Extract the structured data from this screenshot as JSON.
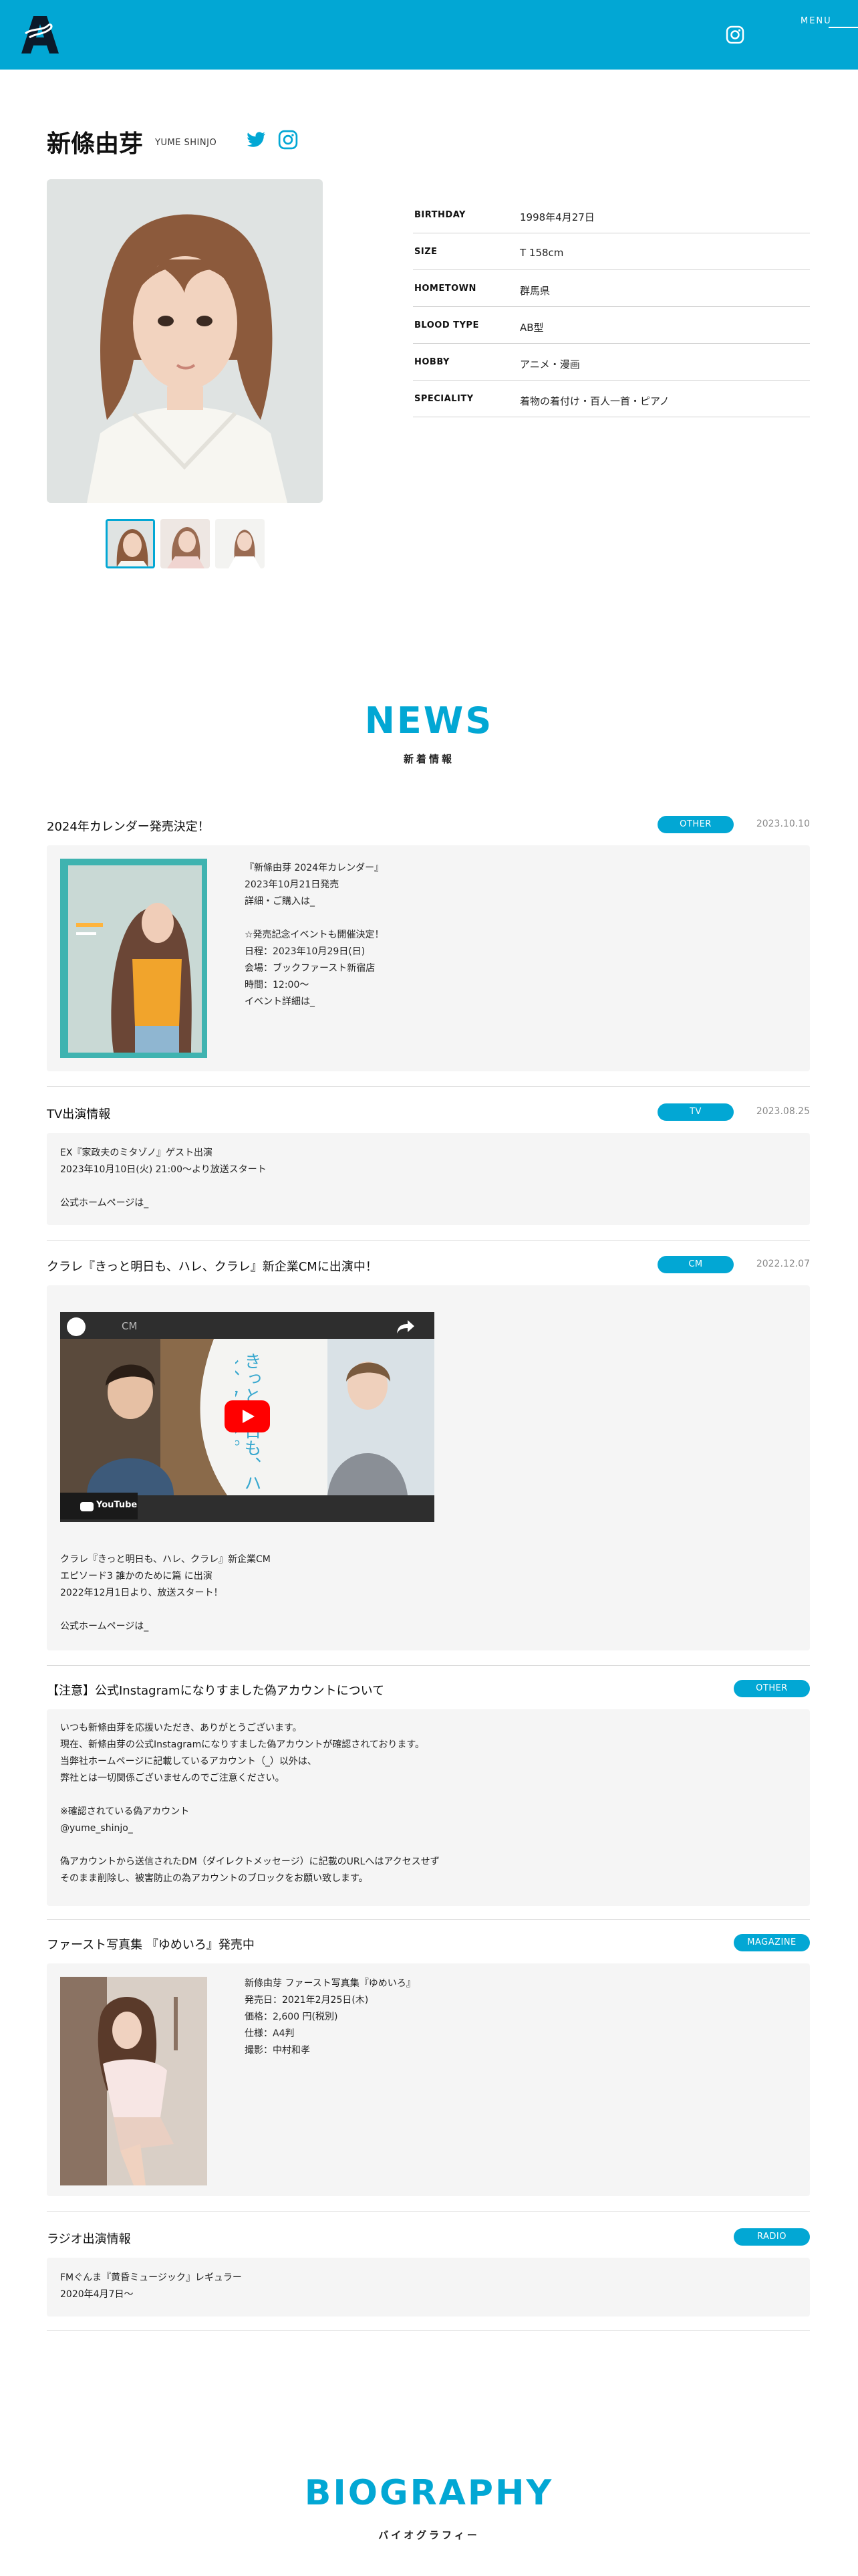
{
  "header": {
    "logo_text": "A",
    "menu_label": "MENU",
    "bg_color": "#02a7d4"
  },
  "profile": {
    "name": "新條由芽",
    "name_roman": "YUME SHINJO",
    "social_icons": [
      "twitter-icon",
      "instagram-icon"
    ],
    "specs": [
      {
        "key": "BIRTHDAY",
        "value": "1998年4月27日"
      },
      {
        "key": "SIZE",
        "value": "T 158cm"
      },
      {
        "key": "HOMETOWN",
        "value": "群馬県"
      },
      {
        "key": "BLOOD TYPE",
        "value": "AB型"
      },
      {
        "key": "HOBBY",
        "value": "アニメ・漫画"
      },
      {
        "key": "SPECIALITY",
        "value": "着物の着付け・百人一首・ピアノ"
      }
    ],
    "thumbnail_count": 3,
    "selected_thumbnail": 1
  },
  "news": {
    "title": "NEWS",
    "subtitle": "新着情報",
    "items": [
      {
        "title": "2024年カレンダー発売決定！",
        "category": "OTHER",
        "date": "2023.10.10",
        "body": "『新條由芽 2024年カレンダー』\n2023年10月21日発売\n詳細・ご購入は_\n\n☆発売記念イベントも開催決定！\n日程：2023年10月29日(日)\n会場：ブックファースト新宿店\n時間：12:00〜\nイベント詳細は_"
      },
      {
        "title": "TV出演情報",
        "category": "TV",
        "date": "2023.08.25",
        "body": "EX『家政夫のミタゾノ』ゲスト出演\n2023年10月10日(火) 21:00〜より放送スタート\n\n公式ホームページは_"
      },
      {
        "title": "クラレ『きっと明日も、ハレ、クラレ』新企業CMに出演中！",
        "category": "CM",
        "date": "2022.12.07",
        "video_title": "CM",
        "video_brand": "YouTube",
        "video_caption": "きっと明日も、ハレ、クラレ。",
        "body": "クラレ『きっと明日も、ハレ、クラレ』新企業CM\nエピソード3 誰かのために篇 に出演\n2022年12月1日より、放送スタート！\n\n公式ホームページは_"
      },
      {
        "title": "【注意】公式Instagramになりすました偽アカウントについて",
        "category": "OTHER",
        "date": "",
        "body": "いつも新條由芽を応援いただき、ありがとうございます。\n現在、新條由芽の公式Instagramになりすました偽アカウントが確認されております。\n当弊社ホームページに記載しているアカウント（_）以外は、\n弊社とは一切関係ございませんのでご注意ください。\n\n※確認されている偽アカウント\n@yume_shinjo_\n\n偽アカウントから送信されたDM（ダイレクトメッセージ）に記載のURLへはアクセスせず\nそのまま削除し、被害防止の為アカウントのブロックをお願い致します。"
      },
      {
        "title": "ファースト写真集 『ゆめいろ』発売中",
        "category": "MAGAZINE",
        "date": "",
        "body": "新條由芽 ファースト写真集『ゆめいろ』\n発売日：2021年2月25日(木)\n価格：2,600 円(税別)\n仕様：A4判\n撮影：中村和孝"
      },
      {
        "title": "ラジオ出演情報",
        "category": "RADIO",
        "date": "",
        "body": "FMぐんま『黄昏ミュージック』レギュラー\n2020年4月7日〜"
      }
    ]
  },
  "biography": {
    "title": "BIOGRAPHY",
    "subtitle": "バイオグラフィー"
  }
}
